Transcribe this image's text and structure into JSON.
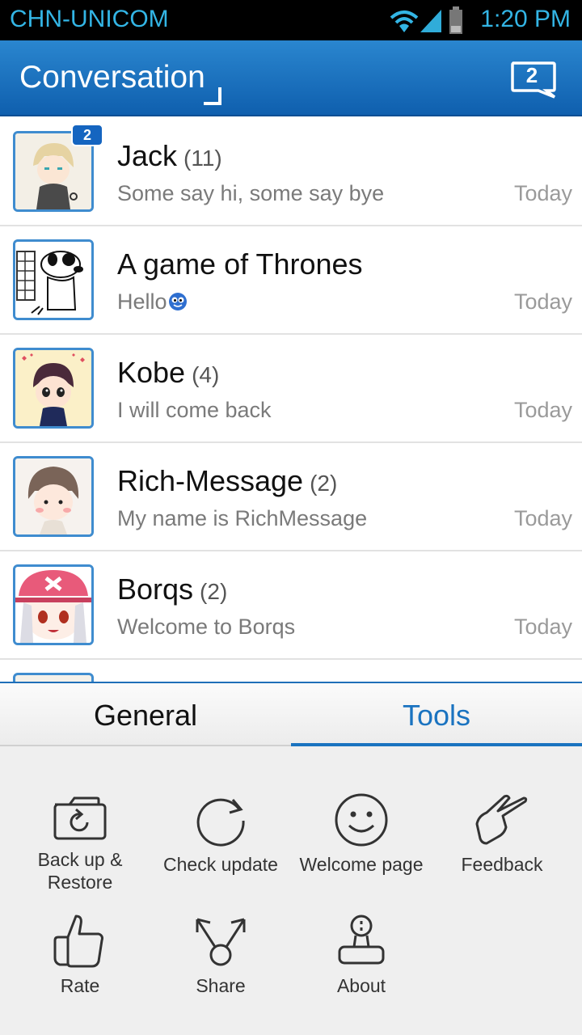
{
  "status_bar": {
    "carrier": "CHN-UNICOM",
    "time": "1:20 PM",
    "icons": [
      "wifi-icon",
      "signal-icon",
      "battery-icon"
    ]
  },
  "action_bar": {
    "title": "Conversation",
    "message_count": "2"
  },
  "conversations": [
    {
      "name": "Jack",
      "count": "(11)",
      "preview": "Some say hi, some say bye",
      "time": "Today",
      "unread": "2"
    },
    {
      "name": "A game of Thrones",
      "count": "",
      "preview": "Hello",
      "time": "Today",
      "unread": ""
    },
    {
      "name": "Kobe",
      "count": "(4)",
      "preview": "I will come back",
      "time": "Today",
      "unread": ""
    },
    {
      "name": "Rich-Message",
      "count": "(2)",
      "preview": "My name is RichMessage",
      "time": "Today",
      "unread": ""
    },
    {
      "name": "Borqs",
      "count": "(2)",
      "preview": "Welcome to Borqs",
      "time": "Today",
      "unread": ""
    }
  ],
  "panel": {
    "tabs": [
      "General",
      "Tools"
    ],
    "active_tab": "Tools",
    "tools": [
      {
        "label": "Back up &\nRestore",
        "icon": "backup-restore-icon"
      },
      {
        "label": "Check update",
        "icon": "refresh-icon"
      },
      {
        "label": "Welcome page",
        "icon": "smiley-icon"
      },
      {
        "label": "Feedback",
        "icon": "feedback-hand-icon"
      },
      {
        "label": "Rate",
        "icon": "thumbs-up-icon"
      },
      {
        "label": "Share",
        "icon": "share-icon"
      },
      {
        "label": "About",
        "icon": "about-stamp-icon"
      }
    ]
  },
  "colors": {
    "accent": "#1a73c0",
    "actionbar": "#1565c0",
    "statusbar_text": "#33b5e5"
  }
}
